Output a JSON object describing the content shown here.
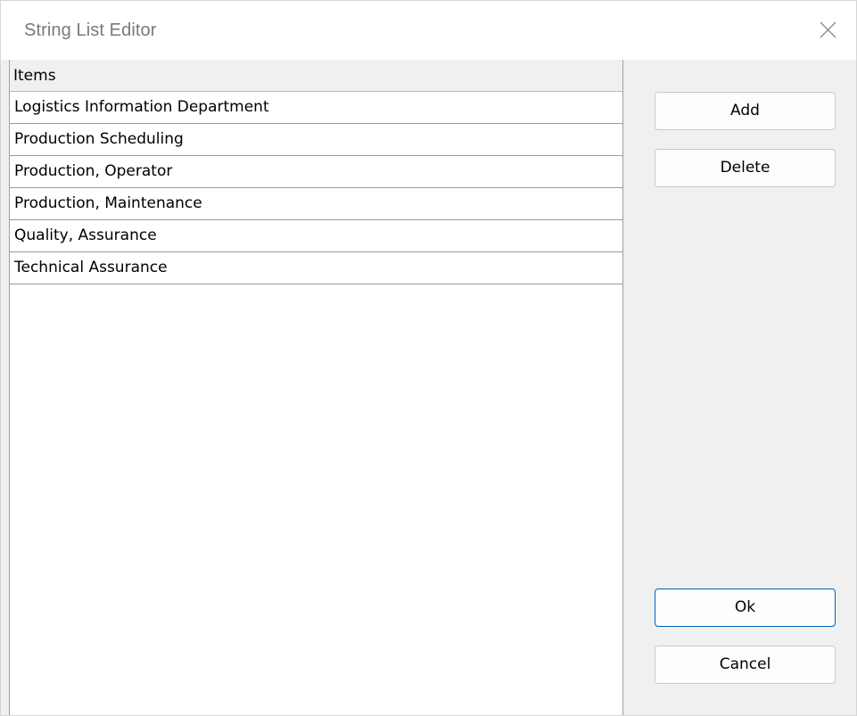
{
  "window": {
    "title": "String List Editor"
  },
  "list": {
    "header": "Items",
    "items": [
      "Logistics Information Department",
      "Production Scheduling",
      "Production, Operator",
      "Production, Maintenance",
      "Quality, Assurance",
      "Technical Assurance"
    ]
  },
  "buttons": {
    "add": "Add",
    "delete": "Delete",
    "ok": "Ok",
    "cancel": "Cancel"
  },
  "icons": {
    "close": "close-icon"
  }
}
